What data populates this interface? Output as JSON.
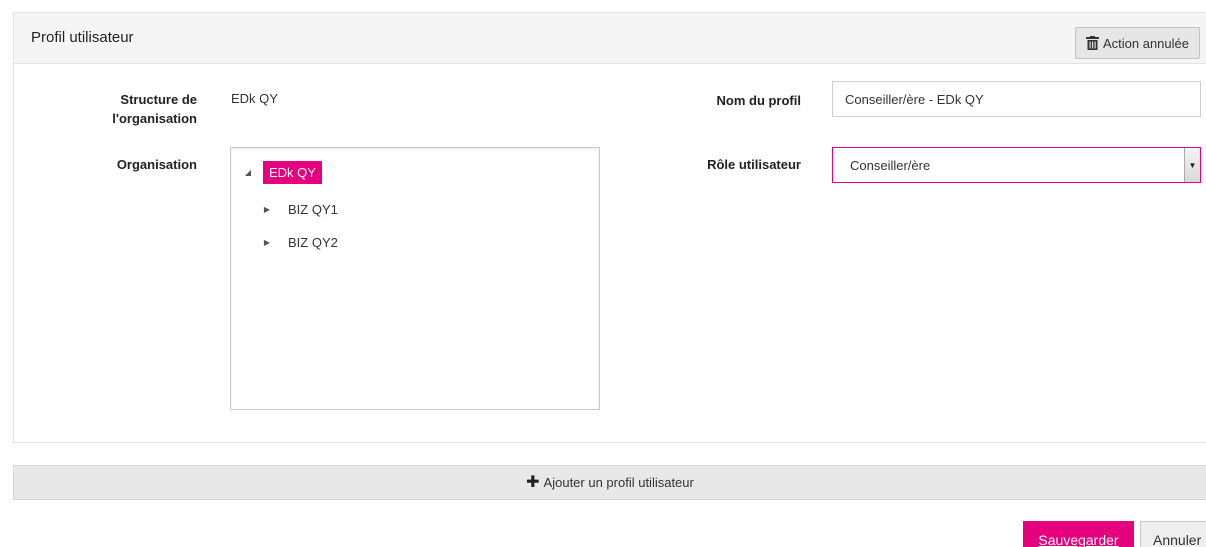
{
  "panel": {
    "title": "Profil utilisateur",
    "cancelled_action_label": "Action annulée"
  },
  "form": {
    "structure_label_line1": "Structure de",
    "structure_label_line2": "l'organisation",
    "structure_value": "EDk QY",
    "organisation_label": "Organisation",
    "profile_name_label": "Nom du profil",
    "profile_name_value": "Conseiller/ère - EDk QY",
    "role_label": "Rôle utilisateur",
    "role_value": "Conseiller/ère"
  },
  "tree": {
    "root": {
      "label": "EDk QY",
      "expanded": true,
      "selected": true
    },
    "children": [
      {
        "label": "BIZ QY1",
        "expanded": false
      },
      {
        "label": "BIZ QY2",
        "expanded": false
      }
    ]
  },
  "actions": {
    "add_profile_label": "Ajouter un profil utilisateur",
    "save_label": "Sauvegarder",
    "cancel_label": "Annuler"
  },
  "colors": {
    "accent": "#e5007e",
    "header_bg": "#f5f5f5",
    "bar_bg": "#e8e8e8"
  }
}
